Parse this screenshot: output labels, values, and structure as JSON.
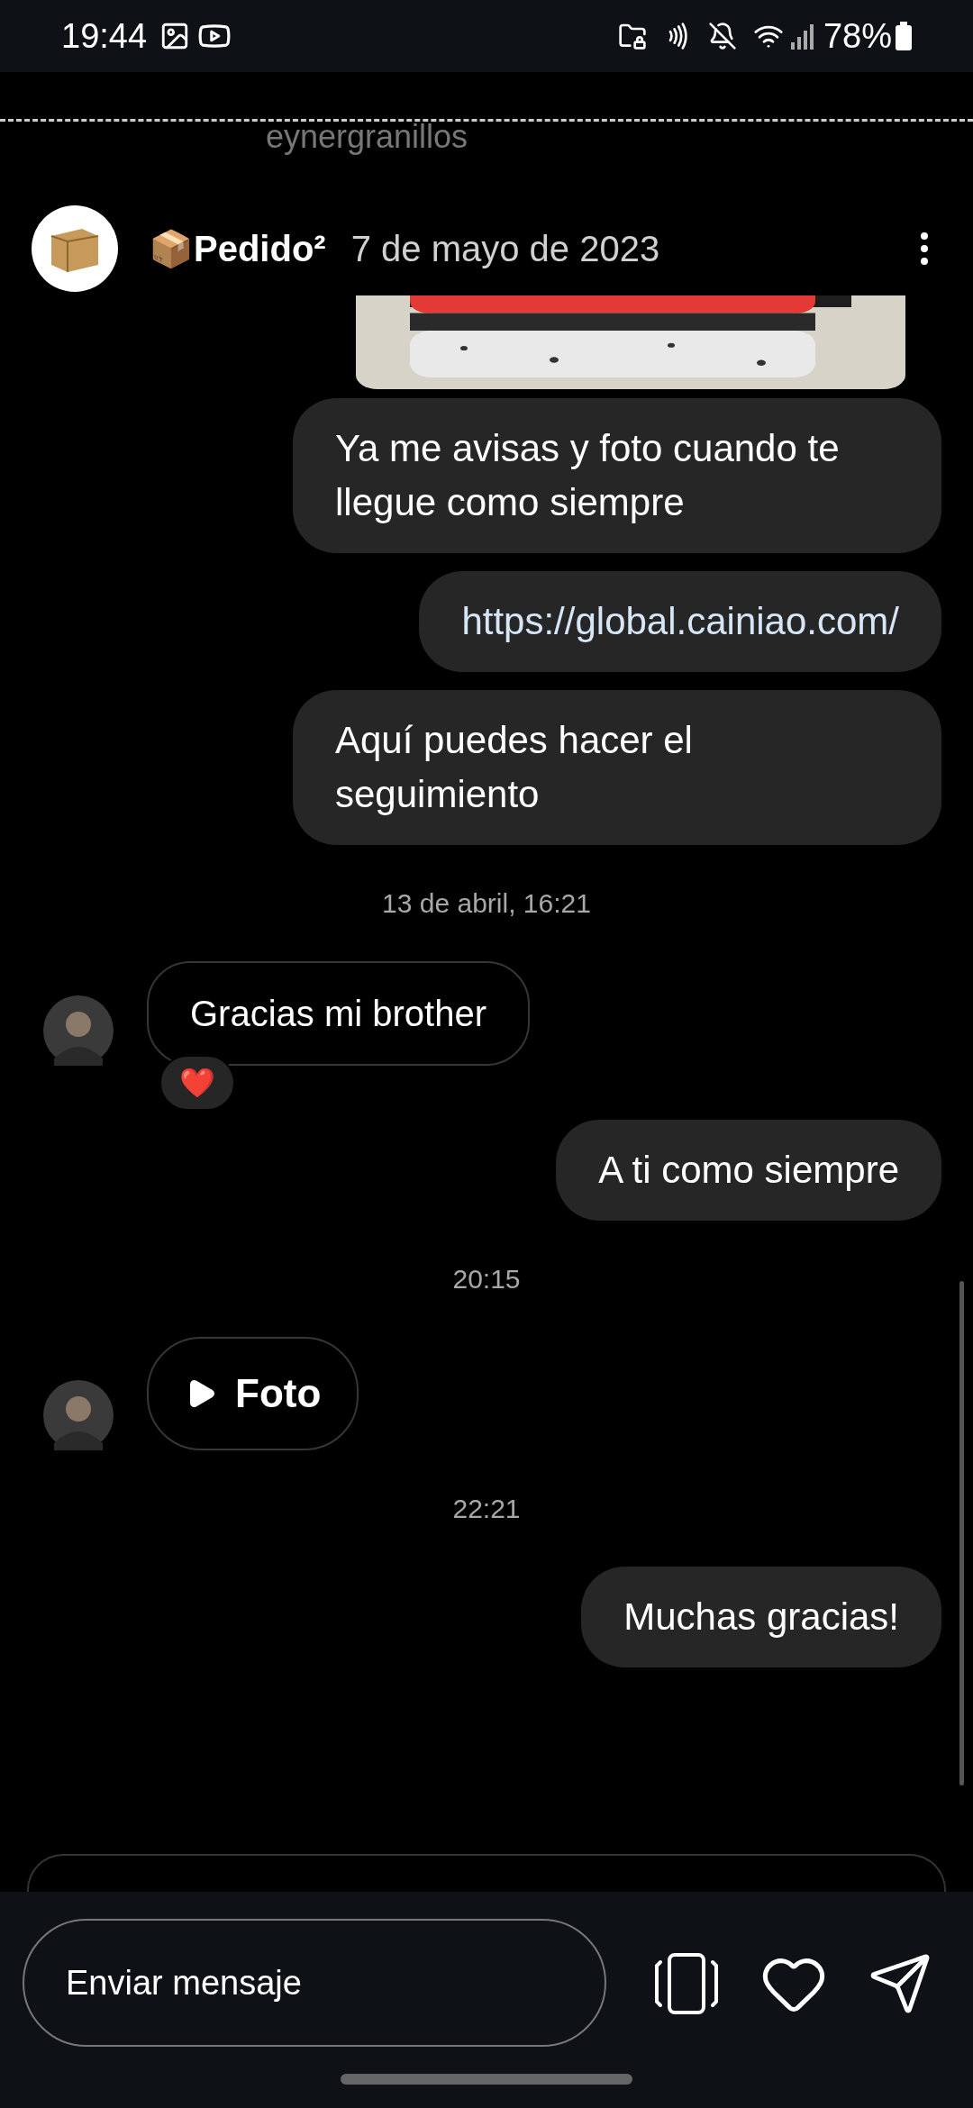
{
  "status_bar": {
    "time": "19:44",
    "battery": "78%"
  },
  "story_header": {
    "username": "eynergranillos"
  },
  "story": {
    "title": "📦Pedido²",
    "date": "7 de mayo de 2023"
  },
  "messages": [
    {
      "kind": "outgoing",
      "text": "Ya me avisas y foto cuando te llegue como siempre"
    },
    {
      "kind": "outgoing_link",
      "text": "https://global.cainiao.com/"
    },
    {
      "kind": "outgoing",
      "text": "Aquí puedes hacer el seguimiento"
    },
    {
      "kind": "timestamp",
      "text": "13 de abril, 16:21"
    },
    {
      "kind": "incoming",
      "text": "Gracias mi brother",
      "reaction": "❤️"
    },
    {
      "kind": "outgoing",
      "text": "A ti como siempre"
    },
    {
      "kind": "timestamp",
      "text": "20:15"
    },
    {
      "kind": "incoming_media",
      "text": "Foto"
    },
    {
      "kind": "timestamp",
      "text": "22:21"
    },
    {
      "kind": "outgoing",
      "text": "Muchas gracias!"
    }
  ],
  "composer": {
    "placeholder": "Enviar mensaje"
  }
}
